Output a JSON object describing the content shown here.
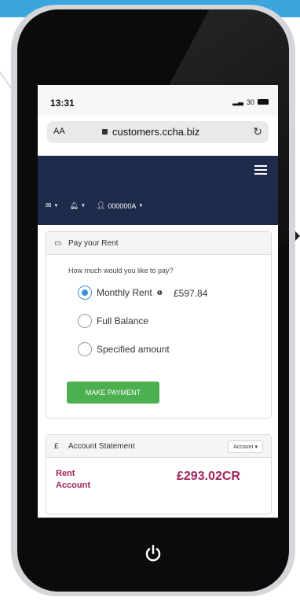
{
  "device": {
    "status_time": "13:31",
    "network": "30"
  },
  "browser": {
    "text_size_label": "AA",
    "url": "customers.ccha.biz"
  },
  "nav": {
    "account_id": "000000A"
  },
  "pay_rent": {
    "title": "Pay your Rent",
    "question": "How much would you like to pay?",
    "options": [
      {
        "label": "Monthly Rent",
        "amount": "£597.84",
        "selected": true
      },
      {
        "label": "Full Balance",
        "amount": "",
        "selected": false
      },
      {
        "label": "Specified amount",
        "amount": "",
        "selected": false
      }
    ],
    "button_label": "MAKE PAYMENT"
  },
  "account_statement": {
    "title": "Account Statement",
    "dropdown_label": "Account",
    "rent_label": "Rent Account",
    "rent_amount": "£293.02CR"
  },
  "colors": {
    "nav_bg": "#1f2b4b",
    "accent_blue": "#3aa6dd",
    "button_green": "#4caf50",
    "amount_magenta": "#a3245e"
  },
  "icons": [
    "mail-icon",
    "bell-icon",
    "user-icon",
    "menu-icon",
    "card-icon",
    "pound-icon",
    "info-icon",
    "lock-icon",
    "reload-icon",
    "power-icon"
  ]
}
